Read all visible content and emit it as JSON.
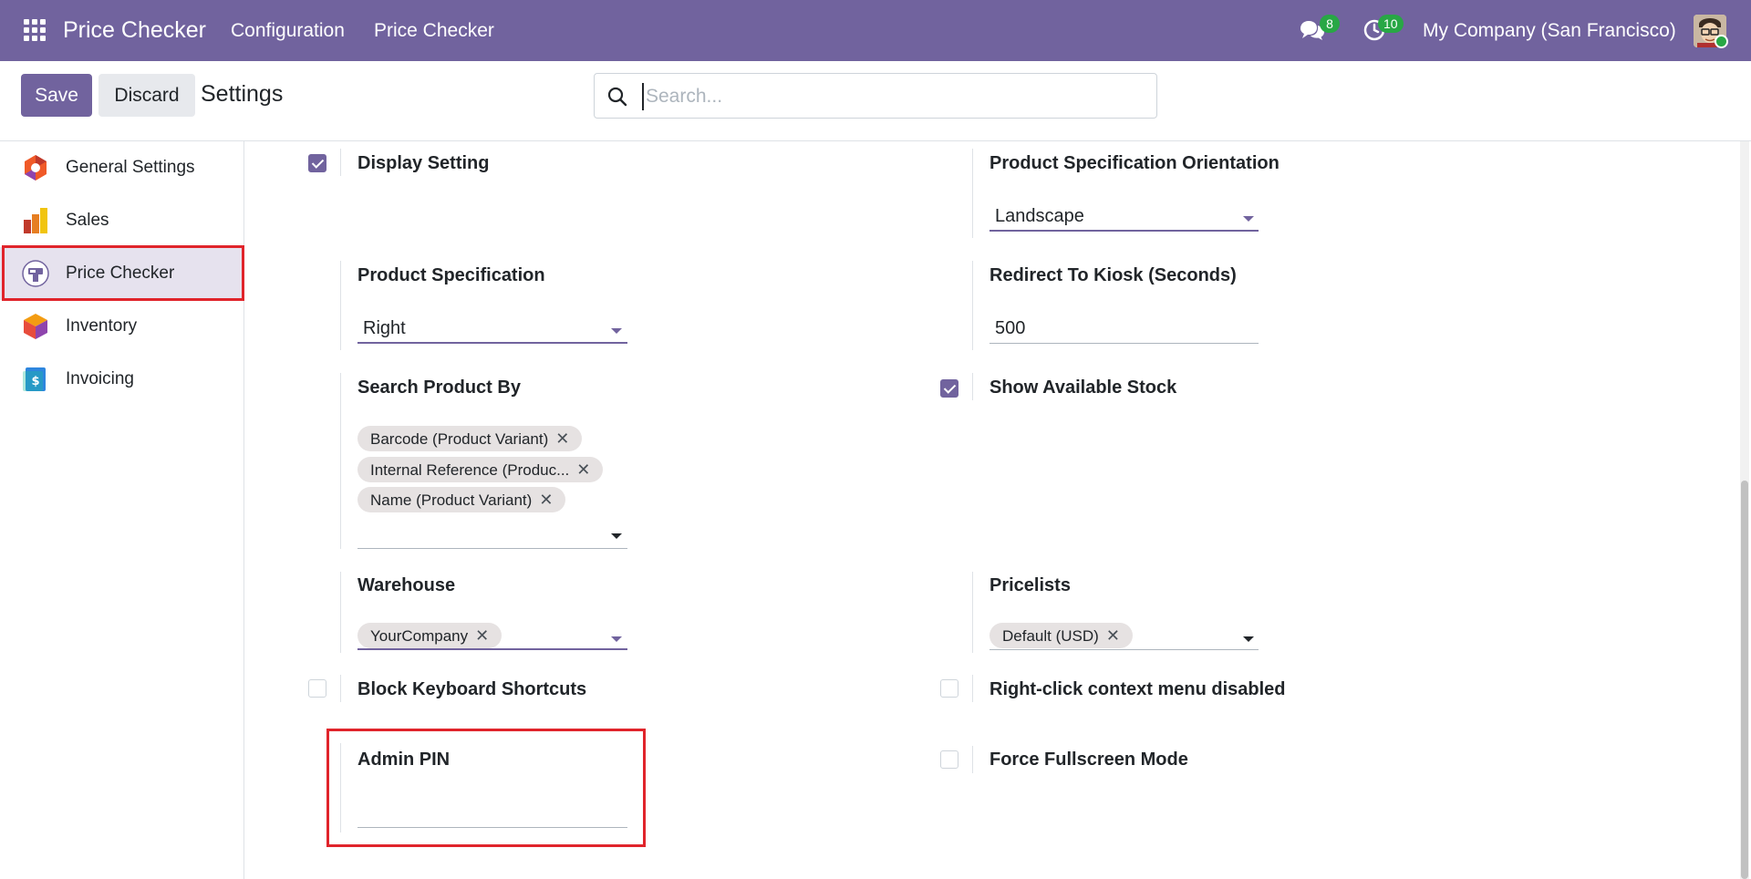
{
  "navbar": {
    "brand": "Price Checker",
    "menu": [
      "Configuration",
      "Price Checker"
    ],
    "chat_badge": "8",
    "activity_badge": "10",
    "company": "My Company (San Francisco)",
    "color": "#71639e"
  },
  "control_panel": {
    "save_label": "Save",
    "discard_label": "Discard",
    "title": "Settings",
    "search_placeholder": "Search..."
  },
  "sidebar": {
    "items": [
      {
        "label": "General Settings",
        "icon": "general-settings-icon"
      },
      {
        "label": "Sales",
        "icon": "sales-icon"
      },
      {
        "label": "Price Checker",
        "icon": "price-checker-icon",
        "active": true
      },
      {
        "label": "Inventory",
        "icon": "inventory-icon"
      },
      {
        "label": "Invoicing",
        "icon": "invoicing-icon"
      }
    ]
  },
  "settings": {
    "display_setting": {
      "label": "Display Setting",
      "checked": true
    },
    "product_spec_orientation": {
      "label": "Product Specification Orientation",
      "value": "Landscape"
    },
    "product_specification": {
      "label": "Product Specification",
      "value": "Right"
    },
    "redirect_to_kiosk": {
      "label": "Redirect To Kiosk (Seconds)",
      "value": "500"
    },
    "search_product_by": {
      "label": "Search Product By",
      "tags": [
        "Barcode (Product Variant)",
        "Internal Reference (Produc...",
        "Name (Product Variant)"
      ]
    },
    "show_available_stock": {
      "label": "Show Available Stock",
      "checked": true
    },
    "warehouse": {
      "label": "Warehouse",
      "tags": [
        "YourCompany"
      ]
    },
    "pricelists": {
      "label": "Pricelists",
      "tags": [
        "Default (USD)"
      ]
    },
    "block_keyboard_shortcuts": {
      "label": "Block Keyboard Shortcuts",
      "checked": false
    },
    "right_click_disabled": {
      "label": "Right-click context menu disabled",
      "checked": false
    },
    "admin_pin": {
      "label": "Admin PIN",
      "value": ""
    },
    "force_fullscreen": {
      "label": "Force Fullscreen Mode",
      "checked": false
    }
  },
  "tag_remove_glyph": "✕"
}
